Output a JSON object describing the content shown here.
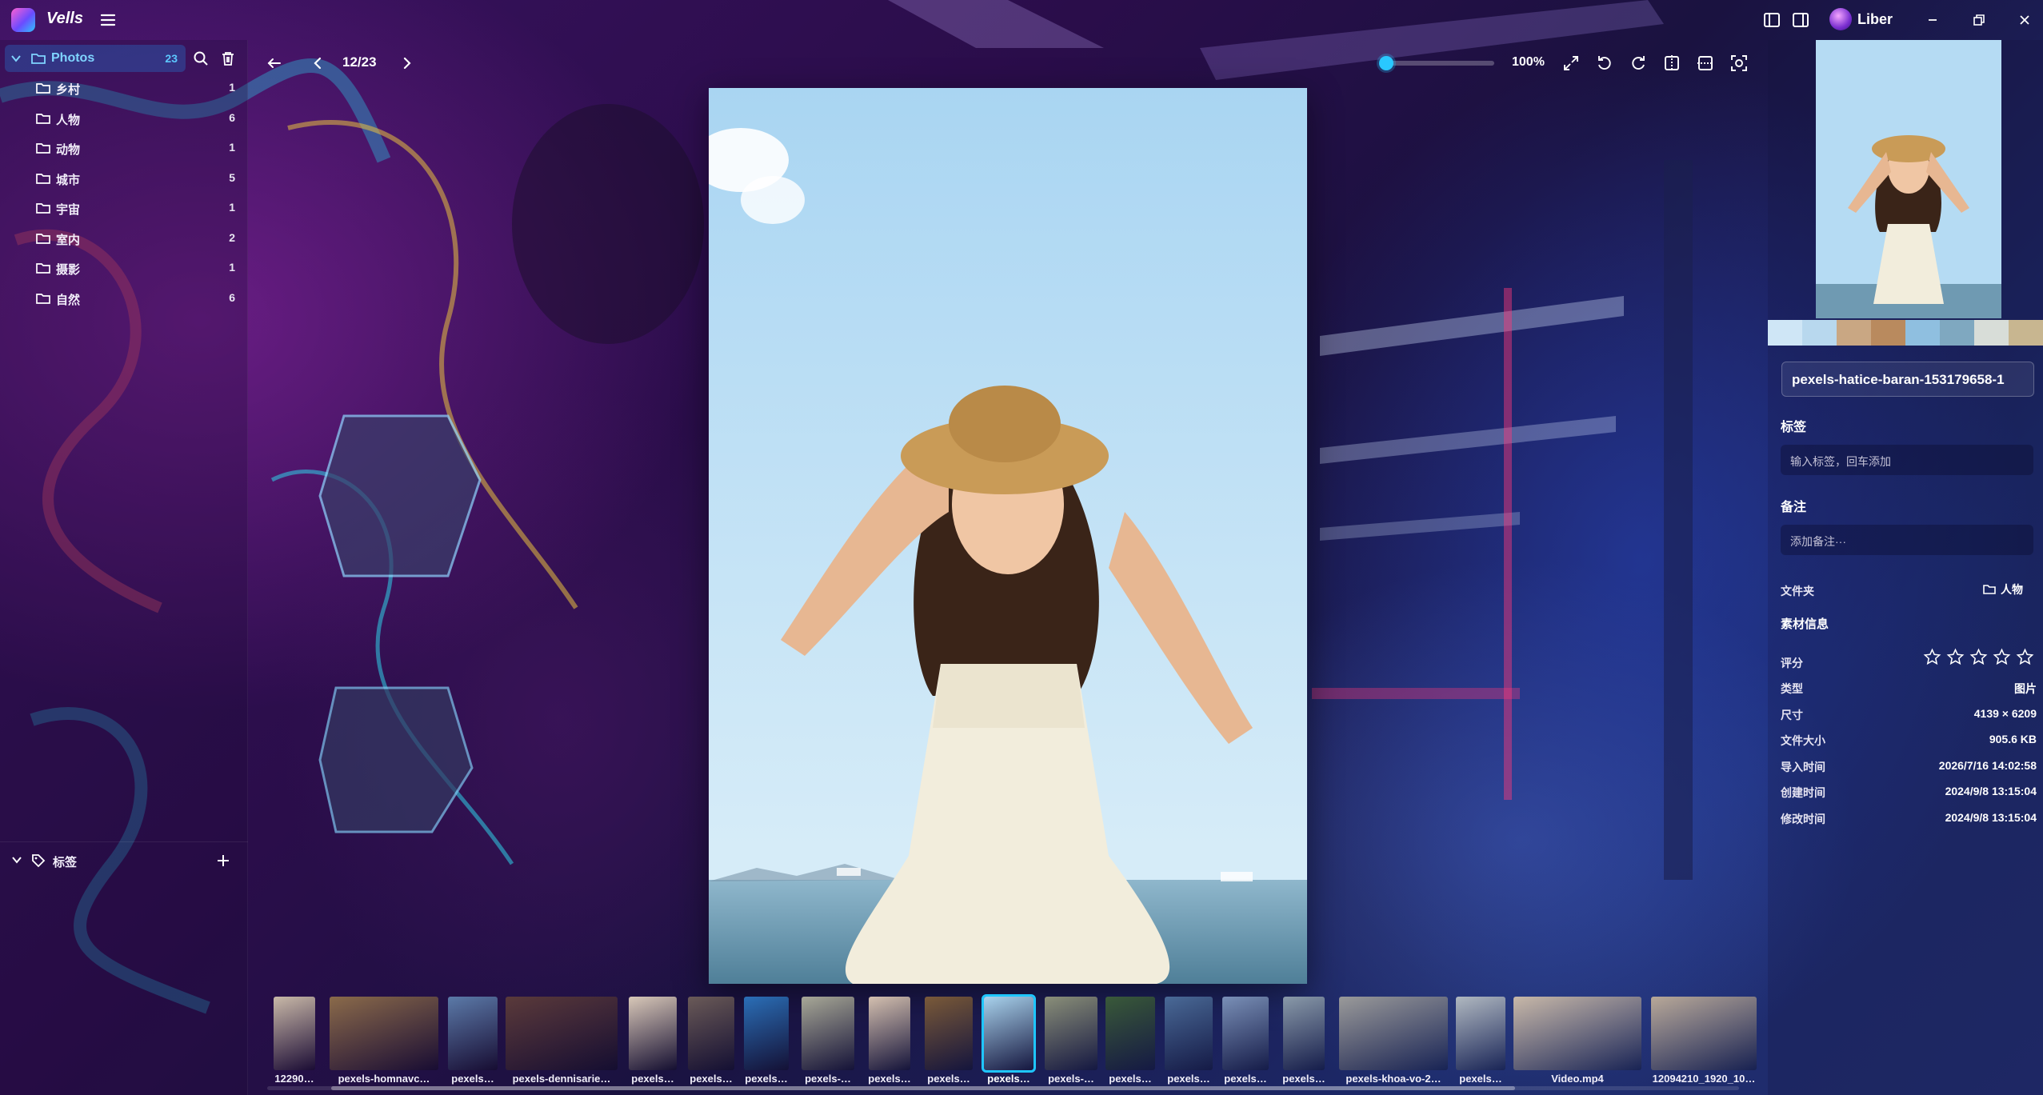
{
  "app": {
    "name": "Vells",
    "user": "Liber"
  },
  "sidebar": {
    "root": {
      "label": "Photos",
      "count": "23"
    },
    "folders": [
      {
        "label": "乡村",
        "count": "1"
      },
      {
        "label": "人物",
        "count": "6"
      },
      {
        "label": "动物",
        "count": "1"
      },
      {
        "label": "城市",
        "count": "5"
      },
      {
        "label": "宇宙",
        "count": "1"
      },
      {
        "label": "室内",
        "count": "2"
      },
      {
        "label": "摄影",
        "count": "1"
      },
      {
        "label": "自然",
        "count": "6"
      }
    ],
    "tags_label": "标签"
  },
  "viewer": {
    "page_indicator": "12/23",
    "zoom_label": "100%",
    "zoom_level": 0.05
  },
  "filmstrip": [
    {
      "label": "12290…",
      "color": "#c9b9a8"
    },
    {
      "label": "pexels-homnavc…",
      "color": "#8a6a4a"
    },
    {
      "label": "pexels…",
      "color": "#5b7aa8"
    },
    {
      "label": "pexels-dennisarie…",
      "color": "#5a3a3a"
    },
    {
      "label": "pexels…",
      "color": "#d8c8b8"
    },
    {
      "label": "pexels…",
      "color": "#6a5a58"
    },
    {
      "label": "pexels…",
      "color": "#2b6fb8"
    },
    {
      "label": "pexels-…",
      "color": "#a8a898"
    },
    {
      "label": "pexels…",
      "color": "#d4c0b0"
    },
    {
      "label": "pexels…",
      "color": "#7a5a3a"
    },
    {
      "label": "pexels…",
      "color": "#a9d3ee",
      "selected": true
    },
    {
      "label": "pexels-…",
      "color": "#8a8f7a"
    },
    {
      "label": "pexels…",
      "color": "#3a5a3a"
    },
    {
      "label": "pexels…",
      "color": "#4a6a98"
    },
    {
      "label": "pexels…",
      "color": "#7a90b8"
    },
    {
      "label": "pexels…",
      "color": "#8a9aaa"
    },
    {
      "label": "pexels-khoa-vo-2…",
      "color": "#9a9a9a"
    },
    {
      "label": "pexels…",
      "color": "#b0b8c0"
    },
    {
      "label": "Video.mp4",
      "color": "#c8b8a8"
    },
    {
      "label": "12094210_1920_10…",
      "color": "#b8a898"
    }
  ],
  "panel": {
    "filename": "pexels-hatice-baran-153179658-1",
    "palette": [
      "#cfe6f6",
      "#b8d8ee",
      "#c9a783",
      "#b98a5e",
      "#8fbfe0",
      "#7fa8c0",
      "#d8ddd8",
      "#c8b690"
    ],
    "tags_title": "标签",
    "tags_placeholder": "输入标签，回车添加",
    "notes_title": "备注",
    "notes_placeholder": "添加备注···",
    "folder_label": "文件夹",
    "folder_value": "人物",
    "info_title": "素材信息",
    "rating_label": "评分",
    "rating": 0,
    "rows": [
      {
        "label": "类型",
        "value": "图片"
      },
      {
        "label": "尺寸",
        "value": "4139 × 6209"
      },
      {
        "label": "文件大小",
        "value": "905.6 KB"
      },
      {
        "label": "导入时间",
        "value": "2026/7/16 14:02:58"
      },
      {
        "label": "创建时间",
        "value": "2024/9/8 13:15:04"
      },
      {
        "label": "修改时间",
        "value": "2024/9/8 13:15:04"
      }
    ]
  }
}
